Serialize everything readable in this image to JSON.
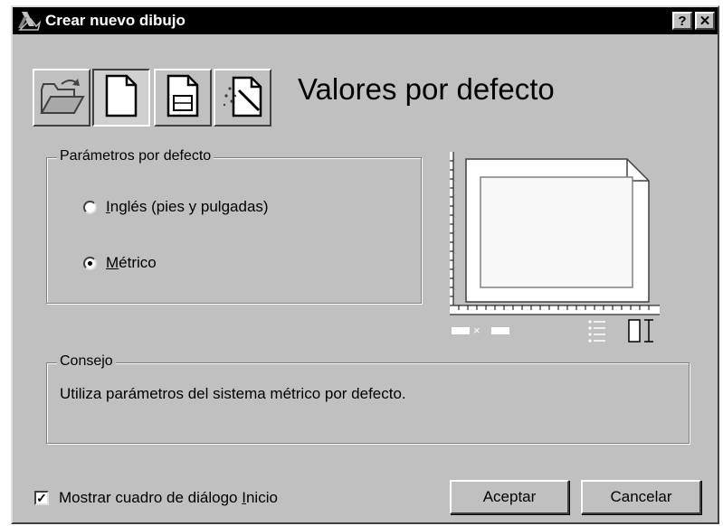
{
  "window": {
    "title": "Crear nuevo dibujo",
    "help_button": "?",
    "close_button": "✕"
  },
  "toolbar": {
    "buttons": [
      {
        "name": "open-drawing",
        "icon": "open-folder-icon",
        "pressed": false
      },
      {
        "name": "start-from-scratch",
        "icon": "blank-page-icon",
        "pressed": true
      },
      {
        "name": "use-template",
        "icon": "template-page-icon",
        "pressed": false
      },
      {
        "name": "use-wizard",
        "icon": "wizard-icon",
        "pressed": false
      }
    ]
  },
  "page_title": "Valores por defecto",
  "defaults_group": {
    "legend": "Parámetros por defecto",
    "options": [
      {
        "mnemonic": "I",
        "rest": "nglés (pies y pulgadas)",
        "checked": false
      },
      {
        "mnemonic": "M",
        "rest": "étrico",
        "checked": true
      }
    ]
  },
  "preview": {
    "dimension_separator": "×",
    "icons": [
      "sheet-preview-icon",
      "dimensions-icon",
      "list-icon",
      "height-icon"
    ]
  },
  "hint": {
    "legend": "Consejo",
    "text": "Utiliza parámetros del sistema métrico por defecto."
  },
  "footer": {
    "checkbox_prefix": "Mostrar cuadro de diálogo ",
    "checkbox_mnemonic": "I",
    "checkbox_suffix": "nicio",
    "checkbox_checked": true,
    "checkbox_mark": "✓",
    "ok_label": "Aceptar",
    "cancel_label": "Cancelar"
  },
  "colors": {
    "dialog_face": "#c0c0c0",
    "titlebar": "#000000",
    "highlight": "#ffffff",
    "shadow": "#404040"
  }
}
